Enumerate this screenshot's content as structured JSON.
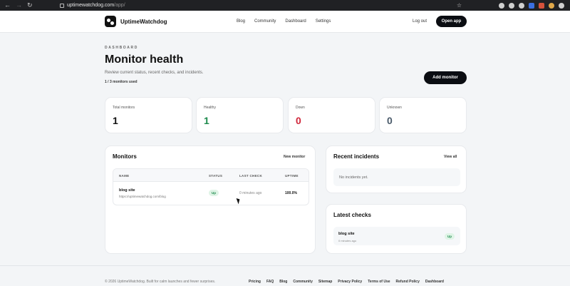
{
  "browser": {
    "url_host": "uptimewatchdog.com",
    "url_path": "/app/"
  },
  "header": {
    "brand": "UptimeWatchdog",
    "nav": [
      "Blog",
      "Community",
      "Dashboard",
      "Settings"
    ],
    "logout": "Log out",
    "open_app": "Open app"
  },
  "hero": {
    "eyebrow": "DASHBOARD",
    "title": "Monitor health",
    "subtitle": "Review current status, recent checks, and incidents.",
    "usage": "1 / 3 monitors used",
    "add_button": "Add monitor"
  },
  "stats": [
    {
      "label": "Total monitors",
      "value": "1",
      "color": "#111111"
    },
    {
      "label": "Healthy",
      "value": "1",
      "color": "#1d8a4c"
    },
    {
      "label": "Down",
      "value": "0",
      "color": "#d0263a"
    },
    {
      "label": "Unknown",
      "value": "0",
      "color": "#4a5a6a"
    }
  ],
  "monitors": {
    "title": "Monitors",
    "new_link": "New monitor",
    "columns": [
      "NAME",
      "STATUS",
      "LAST CHECK",
      "UPTIME"
    ],
    "rows": [
      {
        "name": "blog site",
        "url": "https://uptimewatchdog.com/blog",
        "status": "Up",
        "last_check": "0 minutes ago",
        "uptime": "100.0%"
      }
    ]
  },
  "incidents": {
    "title": "Recent incidents",
    "view_all": "View all",
    "empty": "No incidents yet."
  },
  "checks": {
    "title": "Latest checks",
    "items": [
      {
        "name": "blog site",
        "time": "0 minutes ago",
        "status": "Up"
      }
    ]
  },
  "footer": {
    "copyright": "© 2026 UptimeWatchdog. Built for calm launches and fewer surprises.",
    "links": [
      "Pricing",
      "FAQ",
      "Blog",
      "Community",
      "Sitemap",
      "Privacy Policy",
      "Terms of Use",
      "Refund Policy",
      "Dashboard"
    ]
  }
}
